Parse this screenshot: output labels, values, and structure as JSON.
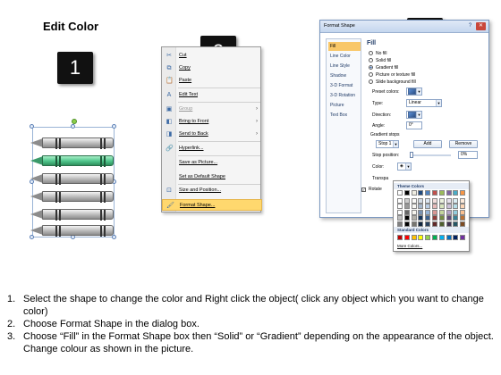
{
  "title": "Edit Color",
  "steps": {
    "one": "1",
    "two": "2",
    "three": "3"
  },
  "context_menu": {
    "items": [
      {
        "icon": "scissors-icon",
        "glyph": "✂",
        "label": "Cut",
        "disabled": false,
        "submenu": false
      },
      {
        "icon": "copy-icon",
        "glyph": "⧉",
        "label": "Copy",
        "disabled": false,
        "submenu": false
      },
      {
        "icon": "paste-icon",
        "glyph": "📋",
        "label": "Paste",
        "disabled": false,
        "submenu": false
      },
      {
        "icon": "edit-text-icon",
        "glyph": "A",
        "label": "Edit Text",
        "disabled": false,
        "submenu": false
      },
      {
        "icon": "group-icon",
        "glyph": "▣",
        "label": "Group",
        "disabled": true,
        "submenu": true
      },
      {
        "icon": "bring-to-front-icon",
        "glyph": "◧",
        "label": "Bring to Front",
        "disabled": false,
        "submenu": true
      },
      {
        "icon": "send-to-back-icon",
        "glyph": "◨",
        "label": "Send to Back",
        "disabled": false,
        "submenu": true
      },
      {
        "icon": "hyperlink-icon",
        "glyph": "🔗",
        "label": "Hyperlink...",
        "disabled": false,
        "submenu": false
      },
      {
        "icon": "save-picture-icon",
        "glyph": "",
        "label": "Save as Picture...",
        "disabled": false,
        "submenu": false
      },
      {
        "icon": "default-shape-icon",
        "glyph": "",
        "label": "Set as Default Shape",
        "disabled": false,
        "submenu": false
      },
      {
        "icon": "size-position-icon",
        "glyph": "⊡",
        "label": "Size and Position...",
        "disabled": false,
        "submenu": false
      },
      {
        "icon": "format-shape-icon",
        "glyph": "🖌",
        "label": "Format Shape...",
        "disabled": false,
        "submenu": false,
        "highlight": true
      }
    ]
  },
  "dialog": {
    "title": "Format Shape",
    "nav": [
      "Fill",
      "Line Color",
      "Line Style",
      "Shadow",
      "3-D Format",
      "3-D Rotation",
      "Picture",
      "Text Box"
    ],
    "active_nav": "Fill",
    "section": "Fill",
    "fill_options": [
      "No fill",
      "Solid fill",
      "Gradient fill",
      "Picture or texture fill",
      "Slide background fill"
    ],
    "selected_fill": "Gradient fill",
    "preset_colors_label": "Preset colors:",
    "type_label": "Type:",
    "type_value": "Linear",
    "direction_label": "Direction:",
    "angle_label": "Angle:",
    "angle_value": "0°",
    "gradient_stops_label": "Gradient stops",
    "stop_value": "Stop 1",
    "add_label": "Add",
    "remove_label": "Remove",
    "stop_position_label": "Stop position:",
    "stop_position_value": "0%",
    "stop_position_fraction": 0.0,
    "color_label": "Color:",
    "transparency_label": "Transpa",
    "rotate_label": "Rotate"
  },
  "color_popup": {
    "theme_colors_label": "Theme Colors",
    "standard_colors_label": "Standard Colors",
    "more_colors_label": "More Colors...",
    "theme_colors": [
      "#ffffff",
      "#000000",
      "#eeece1",
      "#1f497d",
      "#4f81bd",
      "#c0504d",
      "#9bbb59",
      "#8064a2",
      "#4bacc6",
      "#f79646"
    ],
    "standard_colors": [
      "#c00000",
      "#ff0000",
      "#ffc000",
      "#ffff00",
      "#92d050",
      "#00b050",
      "#00b0f0",
      "#0070c0",
      "#002060",
      "#7030a0"
    ]
  },
  "instructions": [
    {
      "num": "1.",
      "text": "Select the shape to change the color and Right click the object( click any object which you want to change color)"
    },
    {
      "num": "2.",
      "text": "Choose Format Shape in the dialog box."
    },
    {
      "num": "3.",
      "text": "Choose “Fill” in the Format Shape box then “Solid” or “Gradient” depending on the appearance of the object. Change colour as shown in the picture."
    }
  ],
  "colors": {
    "highlight": "#ffd86e",
    "selected_crayon": "#4ec48a",
    "crayon": "#b9b9b9"
  }
}
